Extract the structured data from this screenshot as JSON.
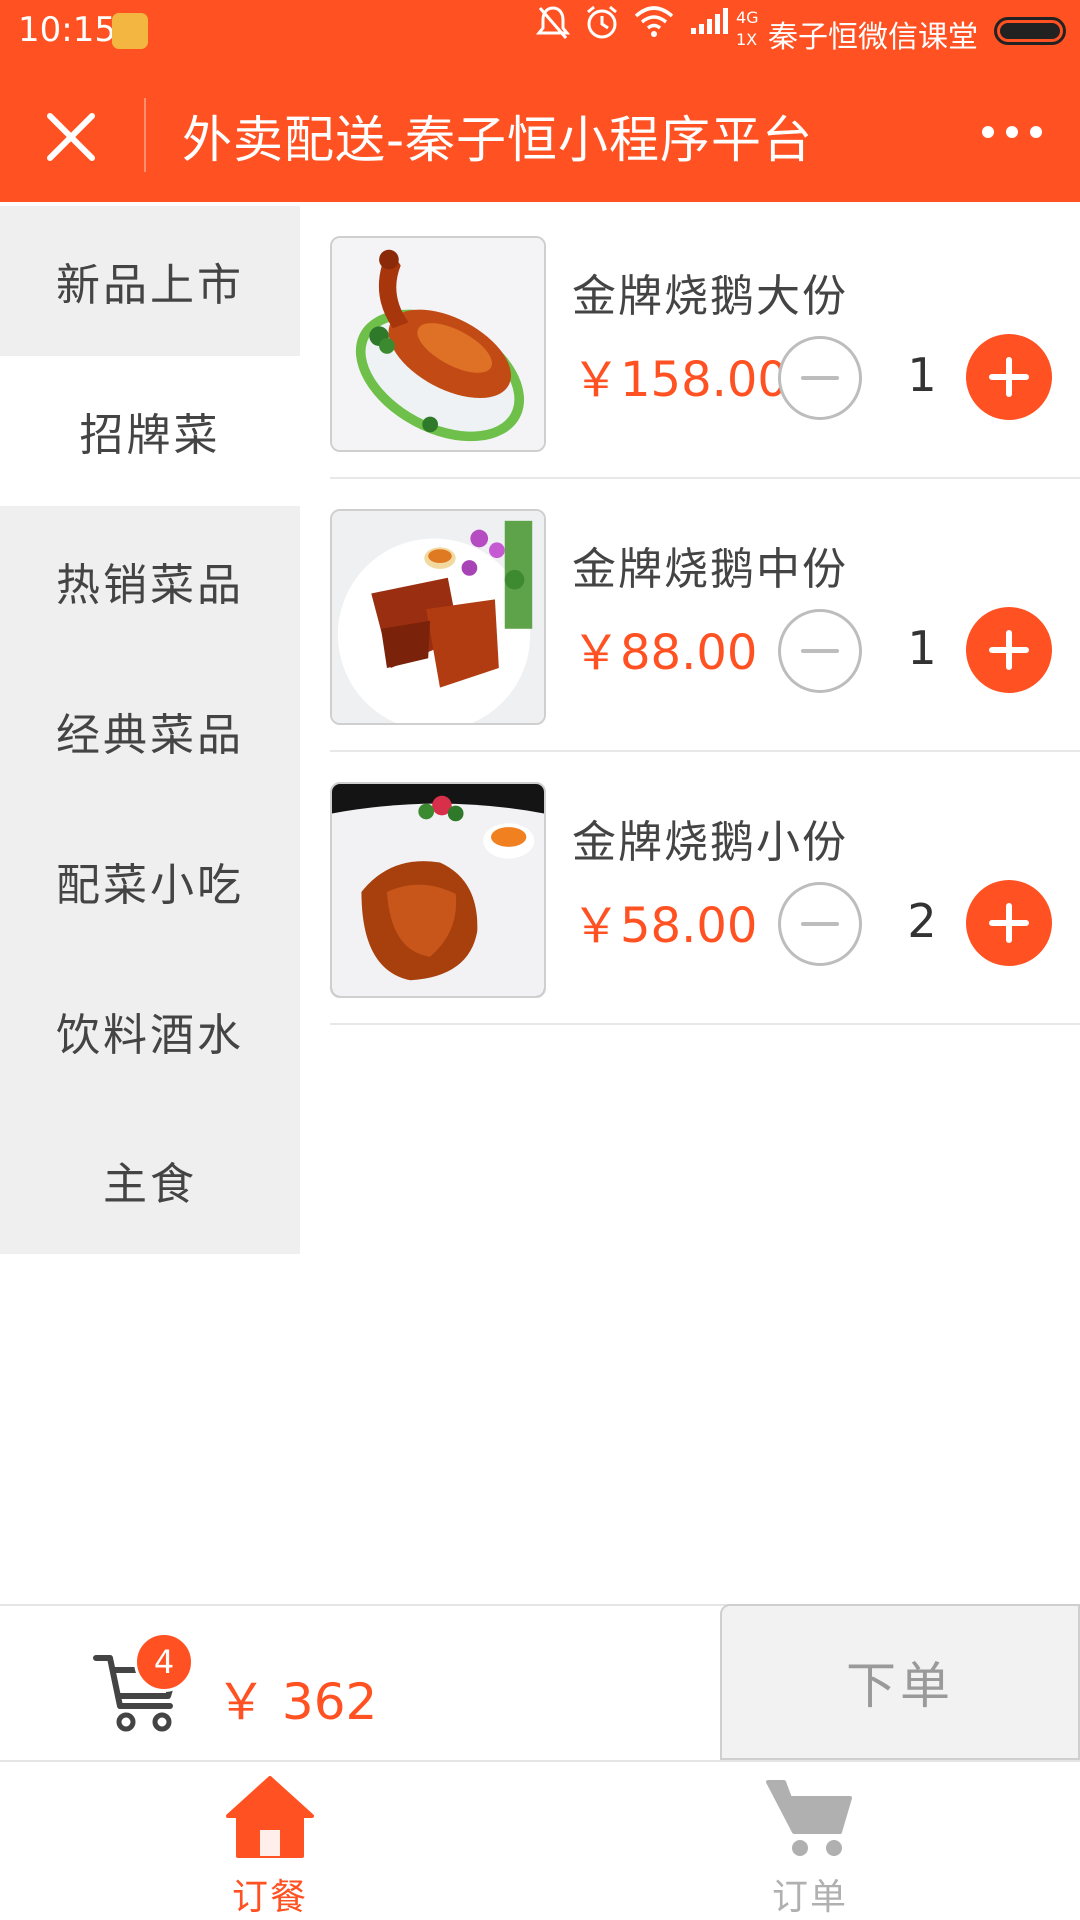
{
  "status_bar": {
    "time": "10:15",
    "carrier": "秦子恒微信课堂",
    "network": "4G",
    "sim": "1X",
    "icons": [
      "mute-icon",
      "alarm-icon",
      "wifi-icon",
      "signal-icon",
      "battery-icon"
    ]
  },
  "nav": {
    "title": "外卖配送-秦子恒小程序平台",
    "close_icon": "close-icon",
    "more_icon": "more-icon"
  },
  "sidebar": {
    "items": [
      {
        "label": "新品上市",
        "active": false
      },
      {
        "label": "招牌菜",
        "active": true
      },
      {
        "label": "热销菜品",
        "active": false
      },
      {
        "label": "经典菜品",
        "active": false
      },
      {
        "label": "配菜小吃",
        "active": false
      },
      {
        "label": "饮料酒水",
        "active": false
      },
      {
        "label": "主食",
        "active": false
      }
    ]
  },
  "products": [
    {
      "name": "金牌烧鹅大份",
      "price": "￥158.00",
      "qty": "1"
    },
    {
      "name": "金牌烧鹅中份",
      "price": "￥88.00",
      "qty": "1"
    },
    {
      "name": "金牌烧鹅小份",
      "price": "￥58.00",
      "qty": "2"
    }
  ],
  "cart": {
    "count": "4",
    "total": "￥ 362",
    "order_label": "下单"
  },
  "tabs": [
    {
      "label": "订餐",
      "icon": "home-icon",
      "active": true
    },
    {
      "label": "订单",
      "icon": "cart-icon",
      "active": false
    }
  ],
  "colors": {
    "accent": "#ff5122",
    "sidebar_bg": "#efefef",
    "tab_active": "#ff5122",
    "tab_inactive": "#b0b0b0"
  }
}
